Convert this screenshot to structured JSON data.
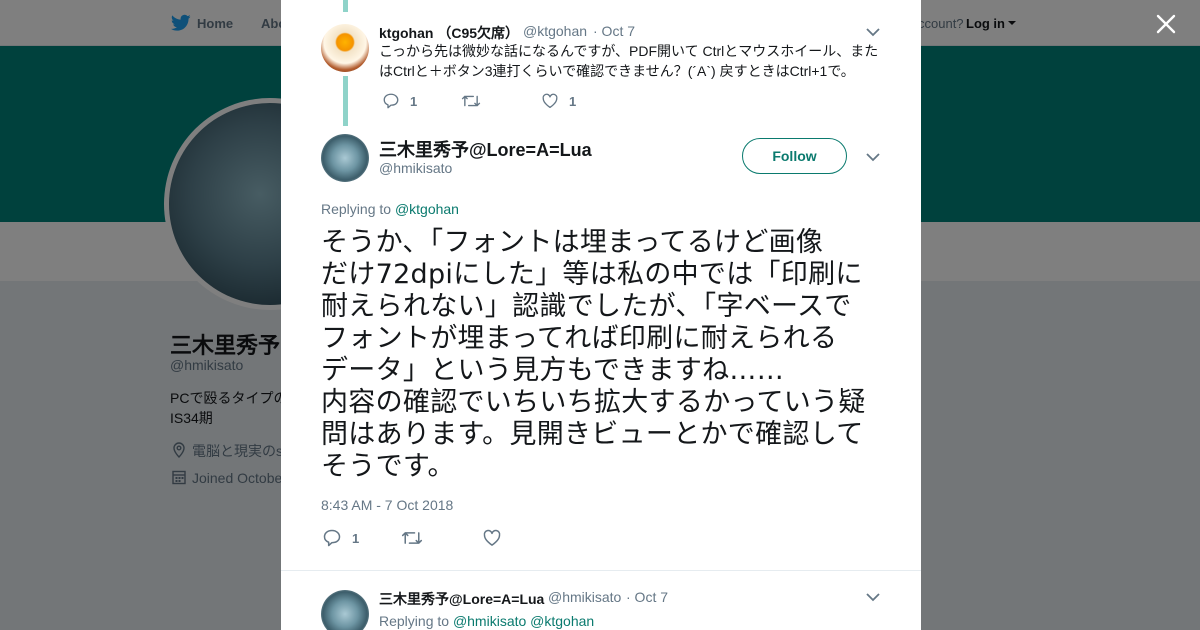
{
  "topbar": {
    "home_label": "Home",
    "about_label": "Abo",
    "account_text": "ccount?",
    "login_label": "Log in"
  },
  "profile": {
    "name": "三木里秀予@",
    "handle": "@hmikisato",
    "bio_line1": "PCで殴るタイプの",
    "bio_line2": "IS34期",
    "location": "電脳と現実のs",
    "joined": "Joined Octobe"
  },
  "thread": {
    "reply_tweet": {
      "name": "ktgohan （C95欠席）",
      "handle": "@ktgohan",
      "date": "· Oct 7",
      "text_line1": "こっから先は微妙な話になるんですが、PDF開いて Ctrlとマウスホイール、また",
      "text_line2": "はCtrlと＋ボタン3連打くらいで確認できません？(´A`) 戻すときはCtrl+1で。",
      "reply_count": "1",
      "retweet_count": "",
      "like_count": "1"
    },
    "main_tweet": {
      "name": "三木里秀予@Lore=A=Lua",
      "handle": "@hmikisato",
      "follow_label": "Follow",
      "replying_prefix": "Replying to ",
      "replying_handle": "@ktgohan",
      "text": "そうか、「フォントは埋まってるけど画像\nだけ72dpiにした」等は私の中では「印刷に\n耐えられない」認識でしたが、「字ベースで\nフォントが埋まってれば印刷に耐えられる\nデータ」という見方もできますね……\n内容の確認でいちいち拡大するかっていう疑\n問はあります。見開きビューとかで確認して\nそうです。",
      "timestamp": "8:43 AM - 7 Oct 2018",
      "reply_count": "1",
      "retweet_count": "",
      "like_count": ""
    },
    "next_tweet": {
      "name": "三木里秀予@Lore=A=Lua",
      "handle": "@hmikisato",
      "date": "· Oct 7",
      "replying_prefix": "Replying to ",
      "replying_handle1": "@hmikisato",
      "replying_handle2": "@ktgohan"
    }
  },
  "colors": {
    "accent": "#0a7a6e",
    "banner": "#00827a",
    "thread_line": "#8fd3c9",
    "muted": "#657786"
  }
}
